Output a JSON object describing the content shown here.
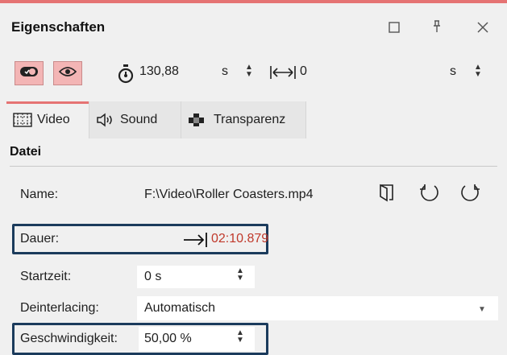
{
  "header": {
    "title": "Eigenschaften",
    "window_buttons": [
      {
        "name": "maximize",
        "icon": "square-icon"
      },
      {
        "name": "pin",
        "icon": "pin-icon"
      },
      {
        "name": "close",
        "icon": "close-icon"
      }
    ]
  },
  "toolbar": {
    "duration_value": "130,88",
    "duration_unit": "s",
    "offset_value": "0",
    "offset_unit": "s"
  },
  "tabs": [
    {
      "label": "Video",
      "icon": "film-icon",
      "active": true
    },
    {
      "label": "Sound",
      "icon": "speaker-icon",
      "active": false
    },
    {
      "label": "Transparenz",
      "icon": "transparency-icon",
      "active": false
    }
  ],
  "section": {
    "title": "Datei"
  },
  "fields": {
    "name": {
      "label": "Name:",
      "value": "F:\\Video\\Roller Coasters.mp4"
    },
    "dauer": {
      "label": "Dauer:",
      "value": "02:10.879"
    },
    "startzeit": {
      "label": "Startzeit:",
      "value": "0 s"
    },
    "deinterlacing": {
      "label": "Deinterlacing:",
      "value": "Automatisch"
    },
    "geschwindigkeit": {
      "label": "Geschwindigkeit:",
      "value": "50,00 %"
    }
  },
  "colors": {
    "accent": "#e57373",
    "highlight_border": "#1b3b5c",
    "duration_red": "#c0392b",
    "toggle_bg": "#f3b5b5"
  }
}
